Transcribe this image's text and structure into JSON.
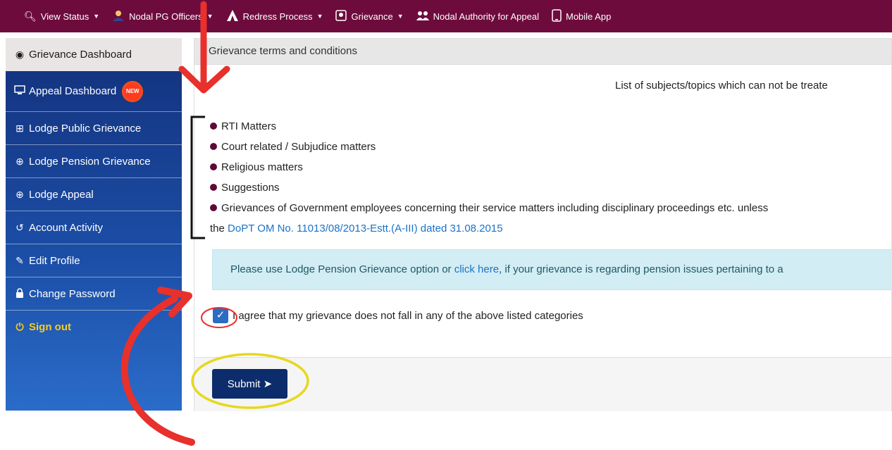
{
  "topnav": {
    "items": [
      {
        "label": "View Status",
        "icon": "search-icon",
        "caret": true
      },
      {
        "label": "Nodal PG Officers",
        "icon": "officer-icon",
        "caret": true
      },
      {
        "label": "Redress Process",
        "icon": "redress-icon",
        "caret": true
      },
      {
        "label": "Grievance",
        "icon": "grievance-icon",
        "caret": true
      },
      {
        "label": "Nodal Authority for Appeal",
        "icon": "users-icon",
        "caret": false
      },
      {
        "label": "Mobile App",
        "icon": "mobile-icon",
        "caret": false
      }
    ]
  },
  "sidebar": {
    "items": [
      {
        "label": "Grievance Dashboard",
        "icon": "dashboard-icon"
      },
      {
        "label": "Appeal Dashboard",
        "icon": "monitor-icon",
        "badge": "NEW"
      },
      {
        "label": "Lodge Public Grievance",
        "icon": "plus-square-icon"
      },
      {
        "label": "Lodge Pension Grievance",
        "icon": "plus-circle-icon"
      },
      {
        "label": "Lodge Appeal",
        "icon": "plus-circle-icon"
      },
      {
        "label": "Account Activity",
        "icon": "history-icon"
      },
      {
        "label": "Edit Profile",
        "icon": "edit-icon"
      },
      {
        "label": "Change Password",
        "icon": "lock-icon"
      },
      {
        "label": "Sign out",
        "icon": "power-icon"
      }
    ]
  },
  "main": {
    "header": "Grievance terms and conditions",
    "list_caption": "List of subjects/topics which can not be treate",
    "rules": [
      "RTI Matters",
      "Court related / Subjudice matters",
      "Religious matters",
      "Suggestions",
      "Grievances of Government employees concerning their service matters including disciplinary proceedings etc. unless"
    ],
    "rule_cont_prefix": "the",
    "rule_link": "DoPT OM No. 11013/08/2013-Estt.(A-III) dated 31.08.2015",
    "info_prefix": "Please use Lodge Pension Grievance option or",
    "info_link": "click here",
    "info_suffix": ", if your grievance is regarding pension issues pertaining to a",
    "agree_text": "I agree that my grievance does not fall in any of the above listed categories",
    "agree_checked": true,
    "submit_label": "Submit"
  },
  "colors": {
    "topnav": "#6e0b3d",
    "sidebar": "#1c4fa8",
    "annotation_red": "#e8302c",
    "annotation_yellow": "#e6d81e",
    "submit": "#0d2c6b"
  }
}
